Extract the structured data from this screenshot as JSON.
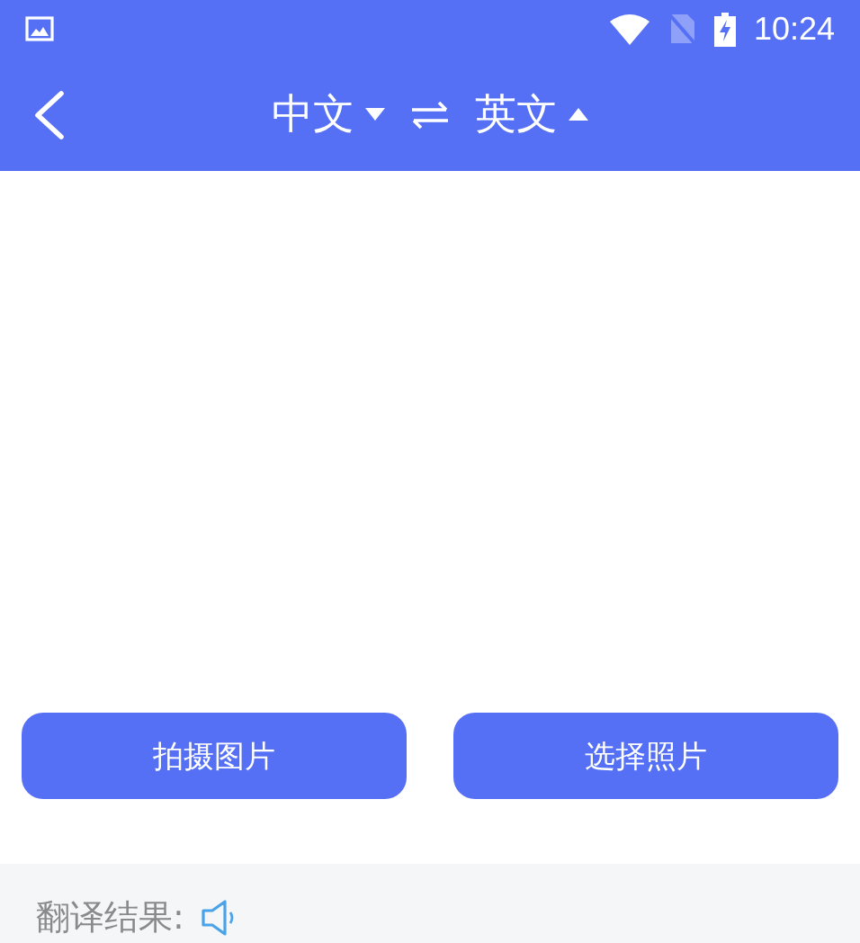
{
  "status_bar": {
    "time": "10:24"
  },
  "header": {
    "languages": [
      {
        "label": "中文",
        "expanded": false
      },
      {
        "label": "英文",
        "expanded": true
      }
    ]
  },
  "buttons": [
    "拍摄图片",
    "选择照片"
  ],
  "result": {
    "label": "翻译结果:"
  }
}
